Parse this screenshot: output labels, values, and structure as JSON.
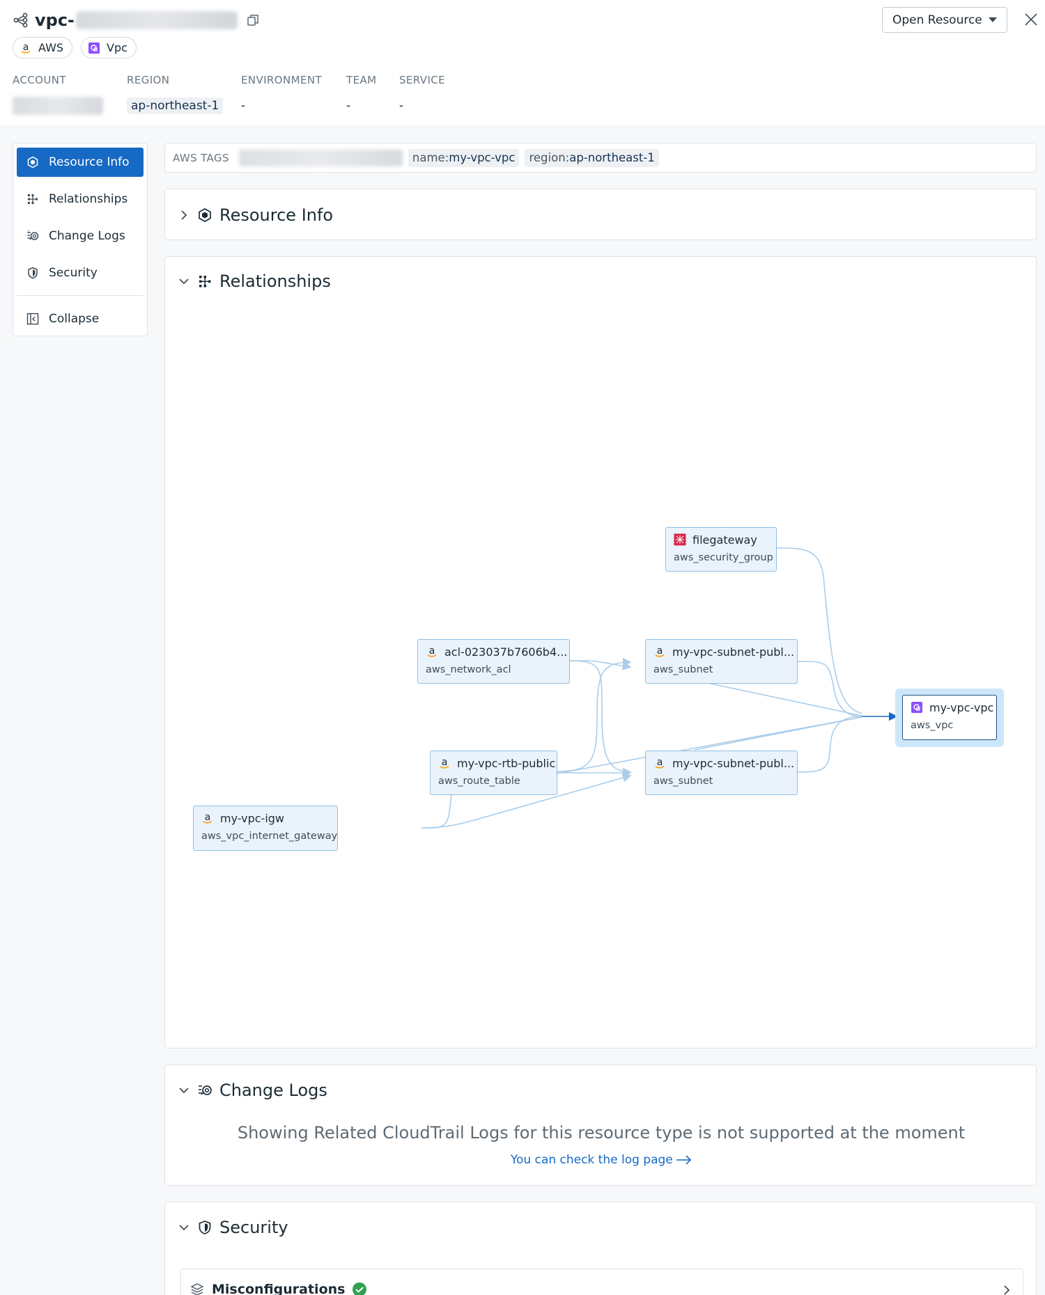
{
  "header": {
    "title_prefix": "vpc-",
    "chips": [
      {
        "label": "AWS",
        "icon": "aws-icon"
      },
      {
        "label": "Vpc",
        "icon": "vpc-icon"
      }
    ],
    "open_resource_label": "Open Resource"
  },
  "meta": {
    "account_label": "ACCOUNT",
    "region_label": "REGION",
    "region_value": "ap-northeast-1",
    "environment_label": "ENVIRONMENT",
    "environment_value": "-",
    "team_label": "TEAM",
    "team_value": "-",
    "service_label": "SERVICE",
    "service_value": "-"
  },
  "sidebar": {
    "items": [
      {
        "label": "Resource Info",
        "icon": "hexagon-icon",
        "active": true
      },
      {
        "label": "Relationships",
        "icon": "relationships-icon"
      },
      {
        "label": "Change Logs",
        "icon": "change-logs-icon"
      },
      {
        "label": "Security",
        "icon": "shield-icon"
      }
    ],
    "collapse_label": "Collapse"
  },
  "tags": {
    "label": "AWS TAGS",
    "items": [
      {
        "key": "name:",
        "value": "my-vpc-vpc"
      },
      {
        "key": "region:",
        "value": "ap-northeast-1"
      }
    ]
  },
  "sections": {
    "resource_info": "Resource Info",
    "relationships": "Relationships",
    "change_logs": "Change Logs",
    "security": "Security"
  },
  "graph": {
    "nodes": {
      "sg": {
        "name": "filegateway",
        "type": "aws_security_group"
      },
      "acl": {
        "name": "acl-023037b7606b4...",
        "type": "aws_network_acl"
      },
      "subnet1": {
        "name": "my-vpc-subnet-publ...",
        "type": "aws_subnet"
      },
      "rtb": {
        "name": "my-vpc-rtb-public",
        "type": "aws_route_table"
      },
      "subnet2": {
        "name": "my-vpc-subnet-publ...",
        "type": "aws_subnet"
      },
      "igw": {
        "name": "my-vpc-igw",
        "type": "aws_vpc_internet_gateway"
      },
      "vpc": {
        "name": "my-vpc-vpc",
        "type": "aws_vpc"
      }
    },
    "edge_color": "#a9cdea",
    "node_border_color": "#8ebfe6"
  },
  "change_logs": {
    "message": "Showing Related CloudTrail Logs for this resource type is not supported at the moment",
    "link": "You can check the log page"
  },
  "security": {
    "misconfigurations_label": "Misconfigurations",
    "status_color": "#2ea44f"
  },
  "colors": {
    "accent": "#1669c4",
    "security_group_red": "#d6294a",
    "vpc_purple": "#8c4fff"
  }
}
